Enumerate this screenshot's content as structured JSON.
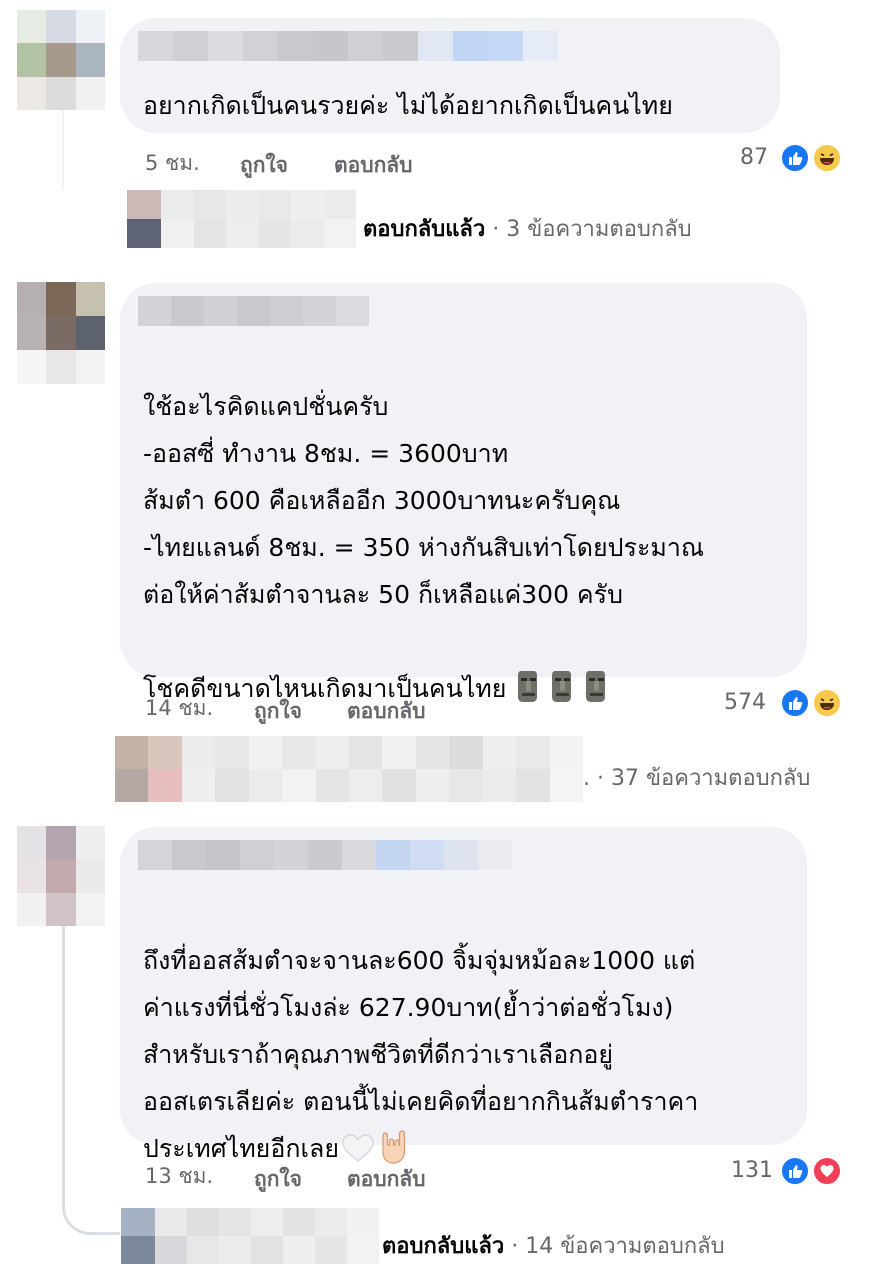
{
  "comments": [
    {
      "text": "อยากเกิดเป็นคนรวยค่ะ ไม่ได้อยากเกิดเป็นคนไทย",
      "time": "5 ชม.",
      "like_label": "ถูกใจ",
      "reply_label": "ตอบกลับ",
      "reaction_count": "87",
      "reactions": [
        "like-icon",
        "haha-icon"
      ],
      "replies": {
        "replied": "ตอบกลับแล้ว",
        "summary": "· 3 ข้อความตอบกลับ"
      }
    },
    {
      "text": "ใช้อะไรคิดแคปชั่นครับ\n-ออสซี่ ทำงาน 8ชม. = 3600บาท\nส้มตำ 600 คือเหลืออีก 3000บาทนะครับคุณ\n-ไทยแลนด์ 8ชม. = 350 ห่างกันสิบเท่าโดยประมาณ\nต่อให้ค่าส้มตำจานละ 50 ก็เหลือแค่300 ครับ\n\nโชคดีขนาดไหนเกิดมาเป็นคนไทย",
      "emoji": [
        "moai-icon",
        "moai-icon",
        "moai-icon"
      ],
      "time": "14 ชม.",
      "like_label": "ถูกใจ",
      "reply_label": "ตอบกลับ",
      "reaction_count": "574",
      "reactions": [
        "like-icon",
        "haha-icon"
      ],
      "replies": {
        "dot": ".",
        "summary": "· 37 ข้อความตอบกลับ"
      }
    },
    {
      "text": "ถึงที่ออสส้มตำจะจานละ600 จิ้มจุ่มหม้อละ1000 แต่\nค่าแรงที่นี่ชั่วโมงล่ะ 627.90บาท(ย้ำว่าต่อชั่วโมง)\nสำหรับเราถ้าคุณภาพชีวิตที่ดีกว่าเราเลือกอยู่\nออสเตรเลียค่ะ ตอนนี้ไม่เคยคิดที่อยากกินส้มตำราคา\nประเทศไทยอีกเลย",
      "emoji": [
        "white-heart-icon",
        "rock-on-hand-icon"
      ],
      "time": "13 ชม.",
      "like_label": "ถูกใจ",
      "reply_label": "ตอบกลับ",
      "reaction_count": "131",
      "reactions": [
        "like-icon",
        "love-icon"
      ],
      "replies": {
        "replied": "ตอบกลับแล้ว",
        "summary": "· 14 ข้อความตอบกลับ"
      }
    }
  ]
}
